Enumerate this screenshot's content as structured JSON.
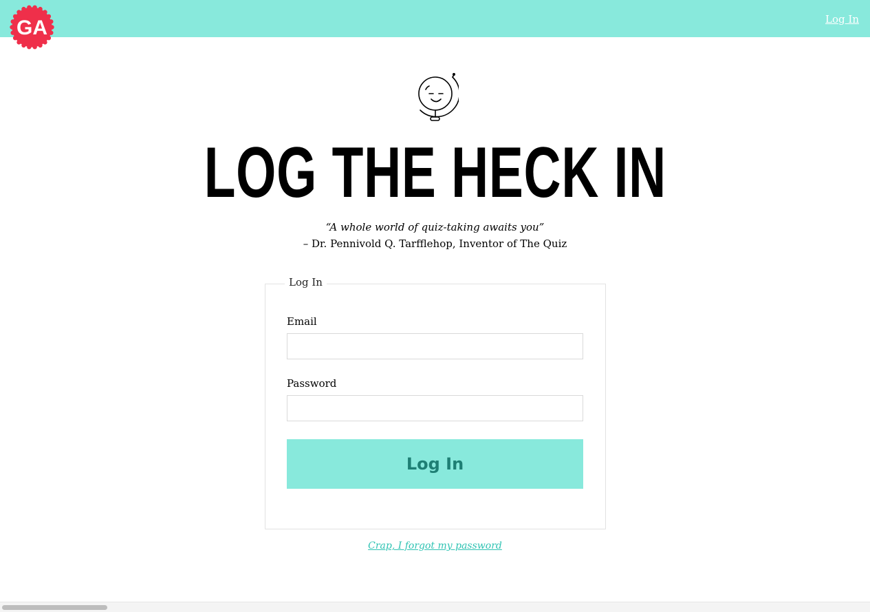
{
  "header": {
    "logo_text": "GA",
    "login_link": "Log In"
  },
  "main": {
    "headline": "LOG THE HECK IN",
    "quote": "“A whole world of quiz-taking awaits you”",
    "attribution": "– Dr. Pennivold Q. Tarfflehop, Inventor of The Quiz"
  },
  "form": {
    "legend": "Log In",
    "email_label": "Email",
    "email_value": "",
    "password_label": "Password",
    "password_value": "",
    "submit_label": "Log In",
    "forgot_link": "Crap, I forgot my password"
  },
  "colors": {
    "brand_teal": "#88e9dc",
    "logo_red": "#ef2f4a",
    "button_text": "#1e7f74",
    "link_teal": "#2fc3b3"
  },
  "icons": {
    "logo": "ga-badge-logo",
    "mascot": "smiling-globe-icon"
  }
}
